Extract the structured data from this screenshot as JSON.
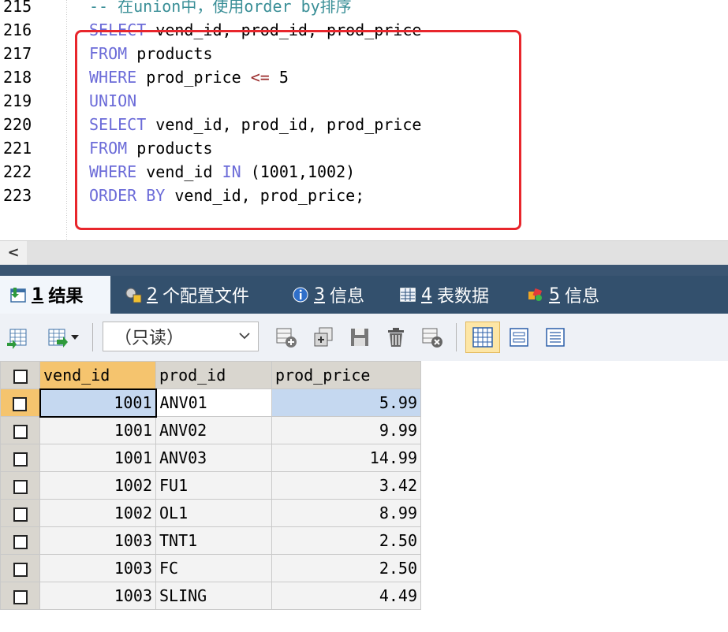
{
  "editor": {
    "lines": [
      {
        "num": "215",
        "segments": [
          {
            "t": "-- 在union中，使用order by排序",
            "c": "cm"
          }
        ]
      },
      {
        "num": "216",
        "segments": [
          {
            "t": "SELECT",
            "c": "kw"
          },
          {
            "t": " vend_id, prod_id, prod_price",
            "c": ""
          }
        ]
      },
      {
        "num": "217",
        "segments": [
          {
            "t": "FROM",
            "c": "kw"
          },
          {
            "t": " products",
            "c": ""
          }
        ]
      },
      {
        "num": "218",
        "segments": [
          {
            "t": "WHERE",
            "c": "kw"
          },
          {
            "t": " prod_price ",
            "c": ""
          },
          {
            "t": "<=",
            "c": "op"
          },
          {
            "t": " 5",
            "c": ""
          }
        ]
      },
      {
        "num": "219",
        "segments": [
          {
            "t": "UNION",
            "c": "kw"
          }
        ]
      },
      {
        "num": "220",
        "segments": [
          {
            "t": "SELECT",
            "c": "kw"
          },
          {
            "t": " vend_id, prod_id, prod_price",
            "c": ""
          }
        ]
      },
      {
        "num": "221",
        "segments": [
          {
            "t": "FROM",
            "c": "kw"
          },
          {
            "t": " products",
            "c": ""
          }
        ]
      },
      {
        "num": "222",
        "segments": [
          {
            "t": "WHERE",
            "c": "kw"
          },
          {
            "t": " vend_id ",
            "c": ""
          },
          {
            "t": "IN",
            "c": "kw"
          },
          {
            "t": " (1001,1002)",
            "c": ""
          }
        ]
      },
      {
        "num": "223",
        "segments": [
          {
            "t": "ORDER BY",
            "c": "kw"
          },
          {
            "t": " vend_id, prod_price;",
            "c": ""
          }
        ]
      }
    ]
  },
  "scrollbar": {
    "left_arrow": "<"
  },
  "tabs": [
    {
      "num": "1",
      "label": "结果",
      "icon": "result-grid-icon"
    },
    {
      "num": "2",
      "label": "个配置文件",
      "icon": "profile-icon"
    },
    {
      "num": "3",
      "label": "信息",
      "icon": "info-icon"
    },
    {
      "num": "4",
      "label": "表数据",
      "icon": "table-data-icon"
    },
    {
      "num": "5",
      "label": "信息",
      "icon": "info-colored-icon"
    }
  ],
  "toolbar": {
    "readonly_label": "（只读）"
  },
  "grid": {
    "columns": [
      "vend_id",
      "prod_id",
      "prod_price"
    ],
    "rows": [
      [
        "1001",
        "ANV01",
        "5.99"
      ],
      [
        "1001",
        "ANV02",
        "9.99"
      ],
      [
        "1001",
        "ANV03",
        "14.99"
      ],
      [
        "1002",
        "FU1",
        "3.42"
      ],
      [
        "1002",
        "OL1",
        "8.99"
      ],
      [
        "1003",
        "TNT1",
        "2.50"
      ],
      [
        "1003",
        "FC",
        "2.50"
      ],
      [
        "1003",
        "SLING",
        "4.49"
      ]
    ]
  },
  "colors": {
    "keyword": "#6b6bd8",
    "comment": "#3a8f97",
    "highlight_box": "#e8262c",
    "tab_bar": "#33506d",
    "header_active": "#f5c46e"
  }
}
